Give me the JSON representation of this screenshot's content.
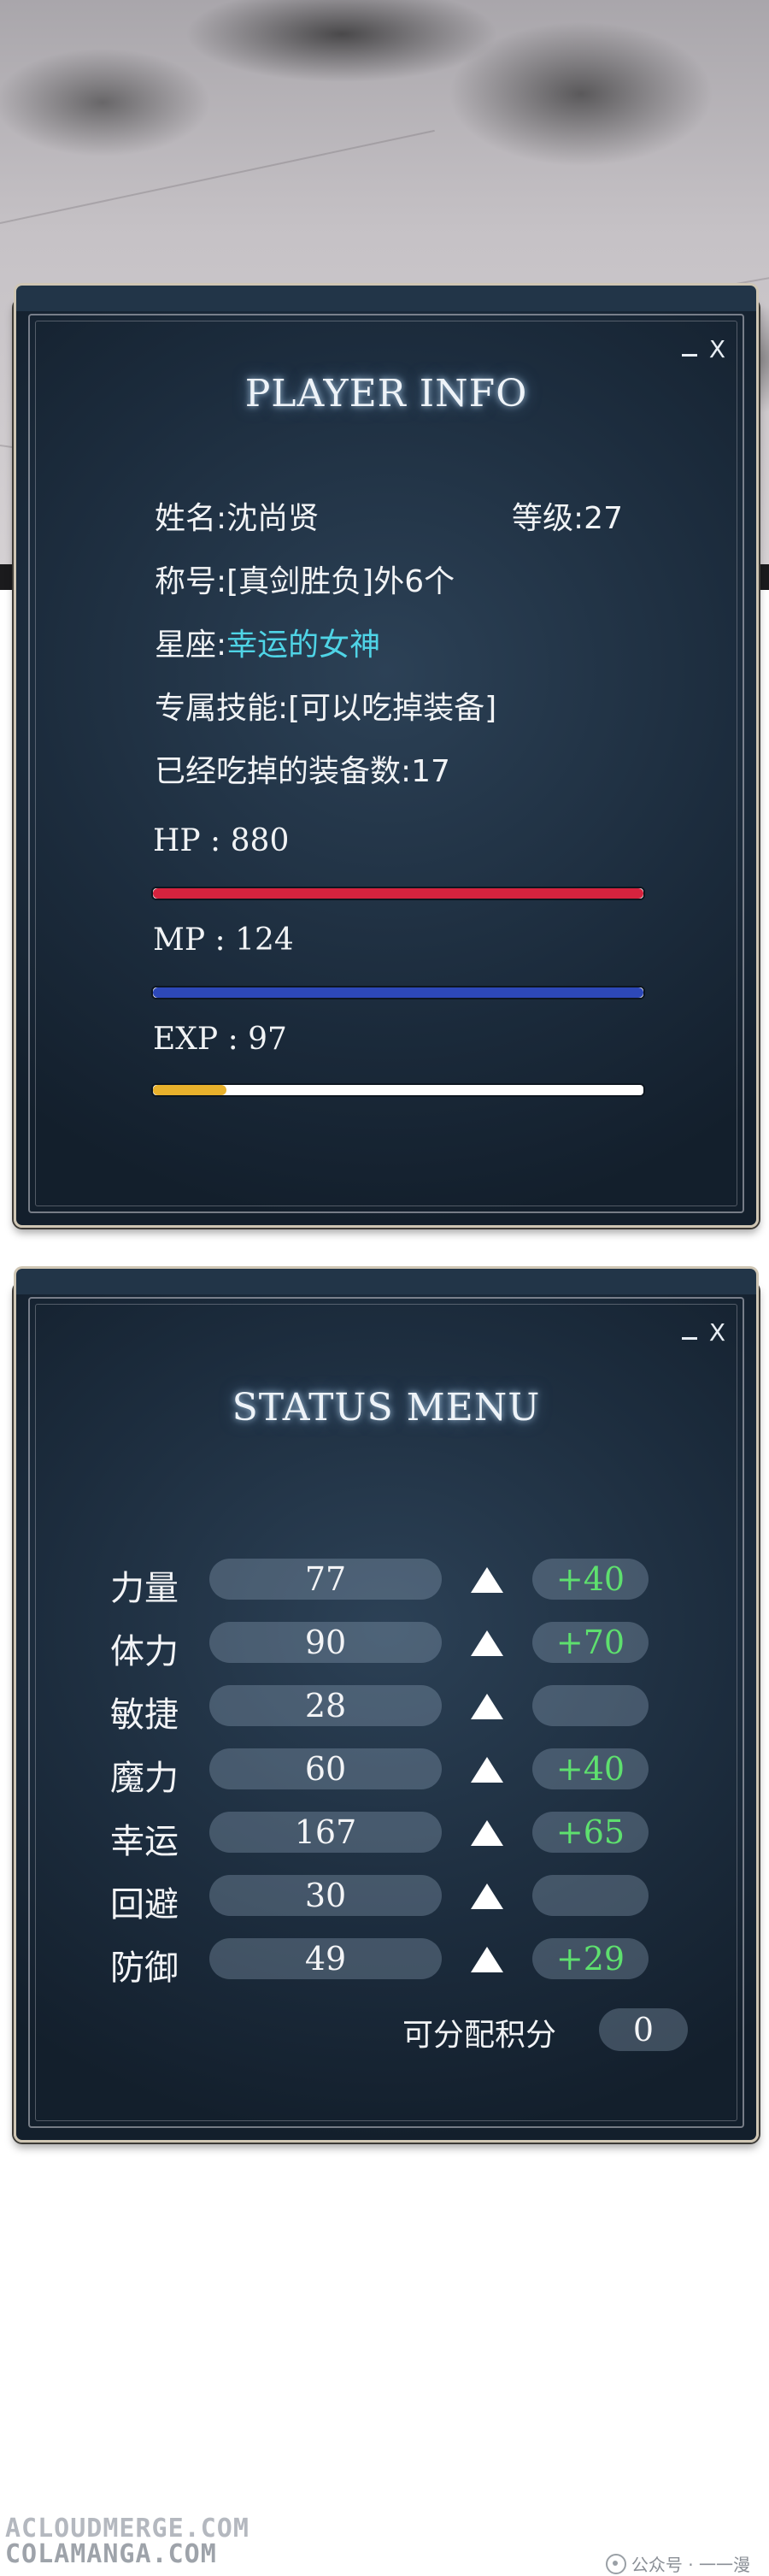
{
  "player_info": {
    "title": "PLAYER INFO",
    "window_controls": {
      "minimize": "",
      "close": "X"
    },
    "name_line": "姓名:沈尚贤",
    "level_line": "等级:27",
    "title_line": "称号:[真剑胜负]外6个",
    "constellation_label": "星座:",
    "constellation_value": "幸运的女神",
    "skill_line": "专属技能:[可以吃掉装备]",
    "eaten_line": "已经吃掉的装备数:17",
    "hp": {
      "label": "HP : 880",
      "fill_fraction": 1.0,
      "color": "#d6233e"
    },
    "mp": {
      "label": "MP : 124",
      "fill_fraction": 1.0,
      "color": "#2d48b8"
    },
    "exp": {
      "label": "EXP : 97",
      "fill_fraction": 0.15,
      "color": "#e8b12c"
    }
  },
  "status_menu": {
    "title": "STATUS MENU",
    "window_controls": {
      "minimize": "",
      "close": "X"
    },
    "stats": [
      {
        "name": "力量",
        "value": "77",
        "bonus": "+40"
      },
      {
        "name": "体力",
        "value": "90",
        "bonus": "+70"
      },
      {
        "name": "敏捷",
        "value": "28",
        "bonus": ""
      },
      {
        "name": "魔力",
        "value": "60",
        "bonus": "+40"
      },
      {
        "name": "幸运",
        "value": "167",
        "bonus": "+65"
      },
      {
        "name": "回避",
        "value": "30",
        "bonus": ""
      },
      {
        "name": "防御",
        "value": "49",
        "bonus": "+29"
      }
    ],
    "points_label": "可分配积分",
    "points_value": "0",
    "bonus_color": "#5ee06e"
  },
  "watermarks": {
    "line1": "ACLOUDMERGE.COM",
    "line2": "COLAMANGA.COM",
    "wechat": "公众号 · 一一漫"
  },
  "icons": [
    "minimize-icon",
    "close-icon",
    "up-arrow-icon",
    "wechat-icon"
  ]
}
